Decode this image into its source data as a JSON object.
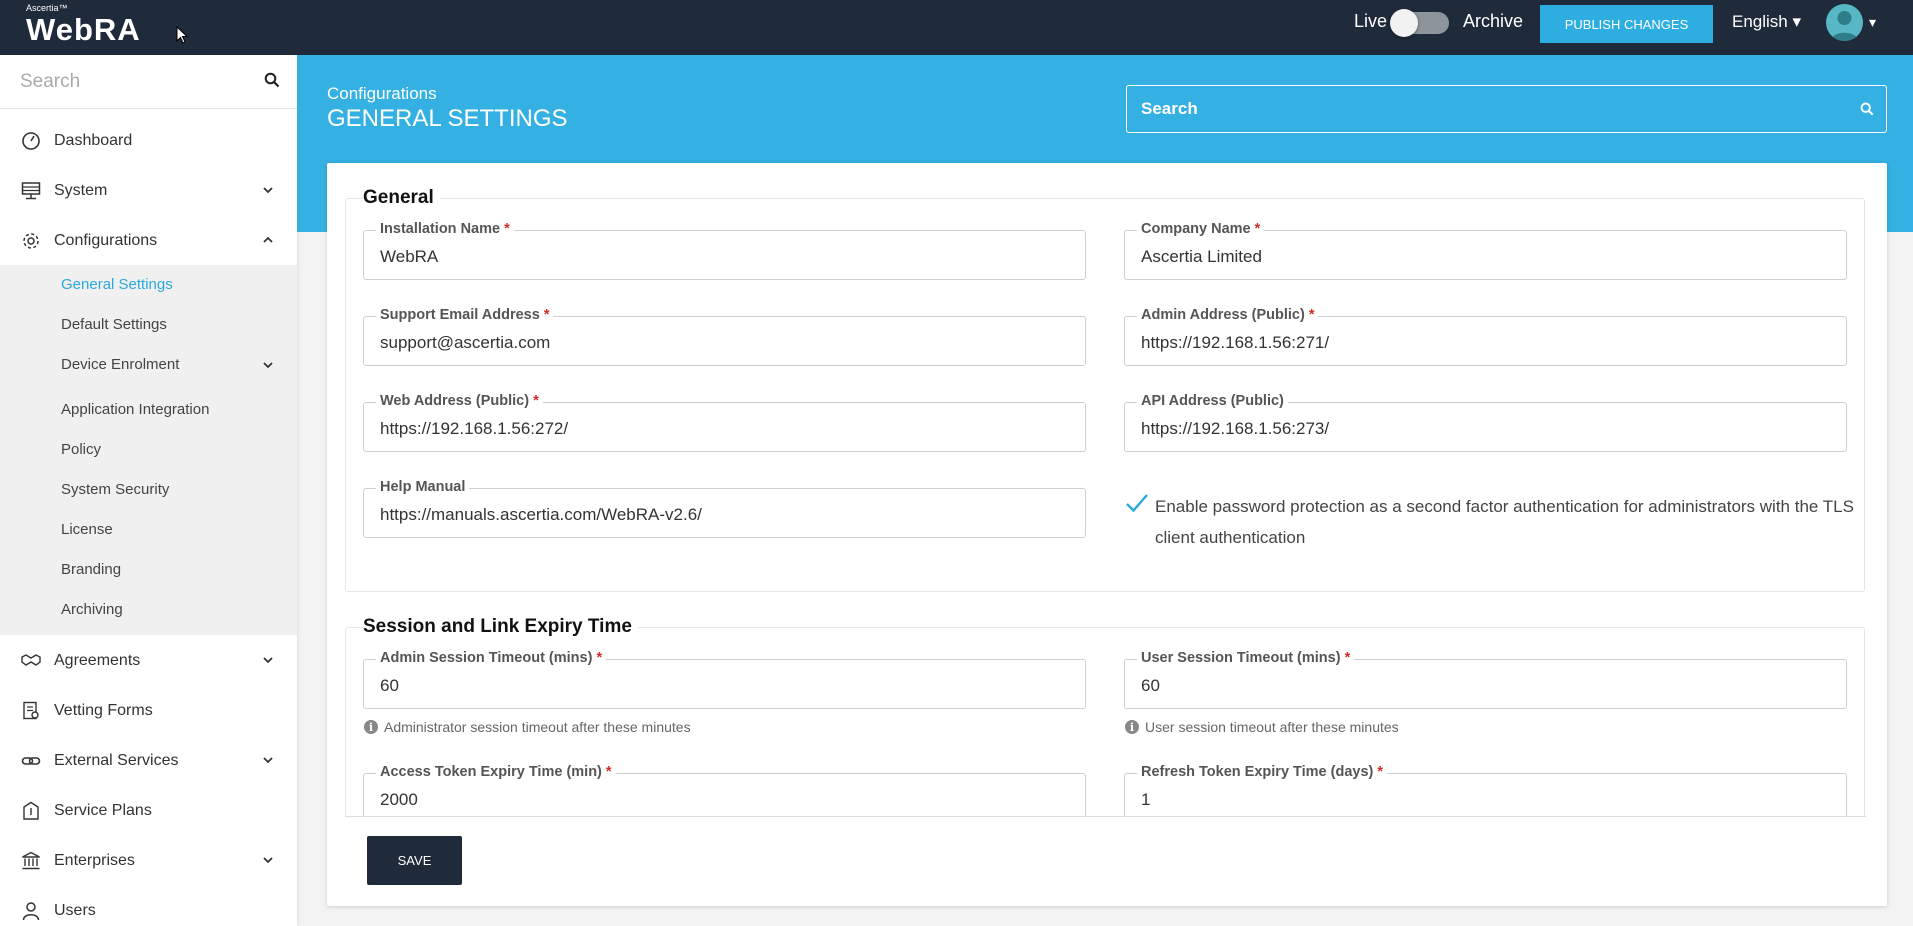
{
  "header": {
    "logo_small": "Ascertia™",
    "logo_big": "WebRA",
    "live_label": "Live",
    "archive_label": "Archive",
    "publish_label": "PUBLISH CHANGES",
    "language": "English ▾",
    "avatar_caret": "▾"
  },
  "sidebar": {
    "search_placeholder": "Search",
    "items": [
      {
        "label": "Dashboard",
        "icon": "dashboard-icon"
      },
      {
        "label": "System",
        "icon": "system-icon"
      },
      {
        "label": "Configurations",
        "icon": "gear-icon"
      },
      {
        "label": "Agreements",
        "icon": "handshake-icon"
      },
      {
        "label": "Vetting Forms",
        "icon": "vetting-forms-icon"
      },
      {
        "label": "External Services",
        "icon": "link-icon"
      },
      {
        "label": "Service Plans",
        "icon": "service-plans-icon"
      },
      {
        "label": "Enterprises",
        "icon": "bank-icon"
      },
      {
        "label": "Users",
        "icon": "users-icon"
      }
    ],
    "sub_items": [
      "General Settings",
      "Default Settings",
      "Device Enrolment",
      "Application Integration",
      "Policy",
      "System Security",
      "License",
      "Branding",
      "Archiving"
    ],
    "active_sub": "General Settings"
  },
  "page": {
    "breadcrumb": "Configurations",
    "title": "GENERAL SETTINGS",
    "search_placeholder": "Search"
  },
  "general": {
    "title": "General",
    "installation_name": {
      "label": "Installation Name",
      "value": "WebRA"
    },
    "company_name": {
      "label": "Company Name",
      "value": "Ascertia Limited"
    },
    "support_email": {
      "label": "Support Email Address",
      "value": "support@ascertia.com"
    },
    "admin_address": {
      "label": "Admin Address (Public)",
      "value": "https://192.168.1.56:271/"
    },
    "web_address": {
      "label": "Web Address (Public)",
      "value": "https://192.168.1.56:272/"
    },
    "api_address": {
      "label": "API Address (Public)",
      "value": "https://192.168.1.56:273/"
    },
    "help_manual": {
      "label": "Help Manual",
      "value": "https://manuals.ascertia.com/WebRA-v2.6/"
    },
    "password_protection": {
      "label": "Enable password protection as a second factor authentication for administrators with the TLS client authentication",
      "checked": true
    }
  },
  "session": {
    "title": "Session and Link Expiry Time",
    "admin_timeout": {
      "label": "Admin Session Timeout (mins)",
      "value": "60",
      "hint": "Administrator session timeout after these minutes"
    },
    "user_timeout": {
      "label": "User Session Timeout (mins)",
      "value": "60",
      "hint": "User session timeout after these minutes"
    },
    "access_token": {
      "label": "Access Token Expiry Time (min)",
      "value": "2000"
    },
    "refresh_token": {
      "label": "Refresh Token Expiry Time (days)",
      "value": "1"
    }
  },
  "actions": {
    "save_label": "SAVE"
  },
  "colors": {
    "topbar": "#1f2a3a",
    "accent": "#35b0e2",
    "required": "#d12c2c"
  }
}
